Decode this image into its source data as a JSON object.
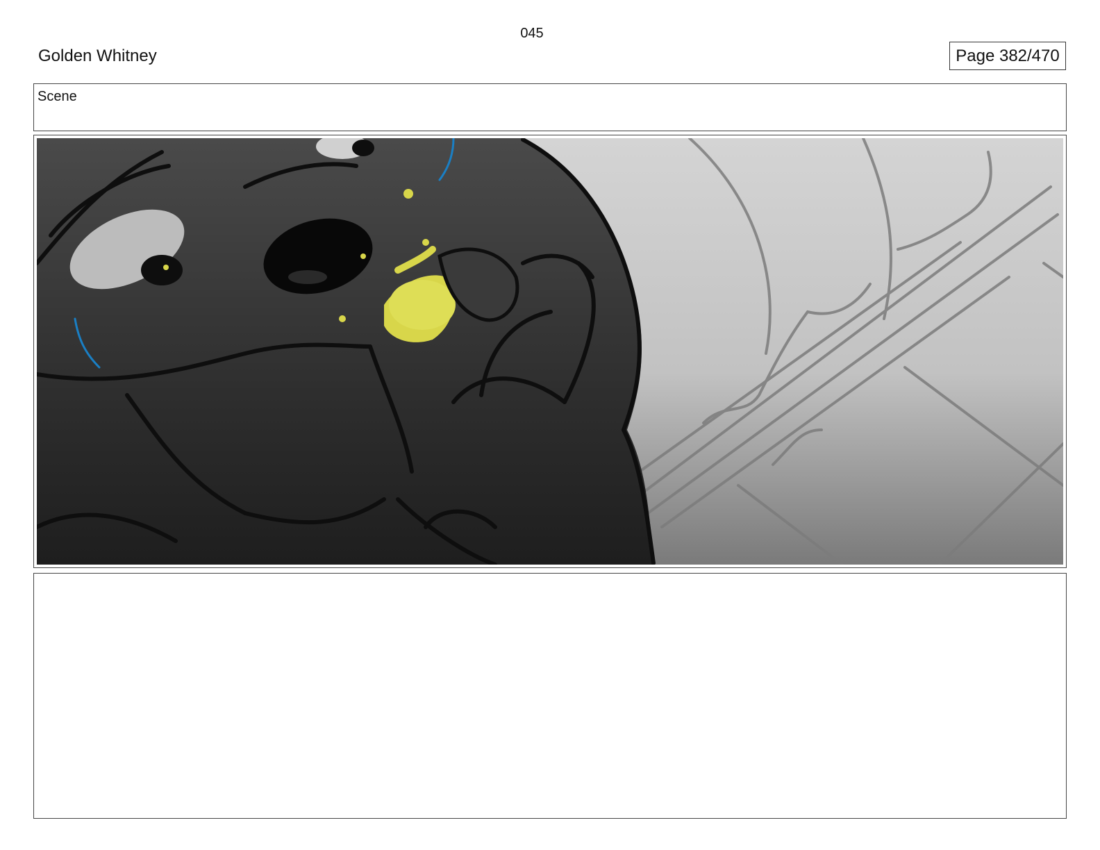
{
  "header": {
    "project_title": "Golden Whitney",
    "page_counter": "Page 382/470"
  },
  "scene": {
    "label": "Scene",
    "number": "045"
  },
  "panel": {
    "colors": {
      "ink": "#0e0e0e",
      "body_dark": "#2c2c2c",
      "background_light": "#d2d2d2",
      "accent_yellow": "#d8d64a",
      "accent_blue": "#1a7fc4"
    }
  },
  "notes": {
    "text": ""
  }
}
